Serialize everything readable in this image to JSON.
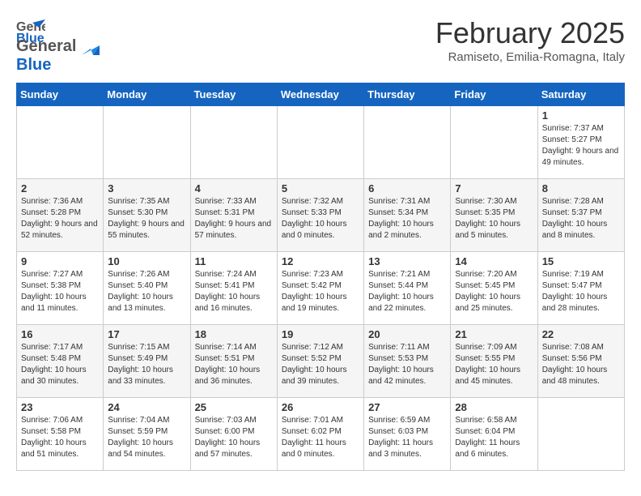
{
  "logo": {
    "general": "General",
    "blue": "Blue"
  },
  "title": "February 2025",
  "location": "Ramiseto, Emilia-Romagna, Italy",
  "weekdays": [
    "Sunday",
    "Monday",
    "Tuesday",
    "Wednesday",
    "Thursday",
    "Friday",
    "Saturday"
  ],
  "rows": [
    {
      "cells": [
        {
          "day": "",
          "info": ""
        },
        {
          "day": "",
          "info": ""
        },
        {
          "day": "",
          "info": ""
        },
        {
          "day": "",
          "info": ""
        },
        {
          "day": "",
          "info": ""
        },
        {
          "day": "",
          "info": ""
        },
        {
          "day": "1",
          "info": "Sunrise: 7:37 AM\nSunset: 5:27 PM\nDaylight: 9 hours and 49 minutes."
        }
      ]
    },
    {
      "cells": [
        {
          "day": "2",
          "info": "Sunrise: 7:36 AM\nSunset: 5:28 PM\nDaylight: 9 hours and 52 minutes."
        },
        {
          "day": "3",
          "info": "Sunrise: 7:35 AM\nSunset: 5:30 PM\nDaylight: 9 hours and 55 minutes."
        },
        {
          "day": "4",
          "info": "Sunrise: 7:33 AM\nSunset: 5:31 PM\nDaylight: 9 hours and 57 minutes."
        },
        {
          "day": "5",
          "info": "Sunrise: 7:32 AM\nSunset: 5:33 PM\nDaylight: 10 hours and 0 minutes."
        },
        {
          "day": "6",
          "info": "Sunrise: 7:31 AM\nSunset: 5:34 PM\nDaylight: 10 hours and 2 minutes."
        },
        {
          "day": "7",
          "info": "Sunrise: 7:30 AM\nSunset: 5:35 PM\nDaylight: 10 hours and 5 minutes."
        },
        {
          "day": "8",
          "info": "Sunrise: 7:28 AM\nSunset: 5:37 PM\nDaylight: 10 hours and 8 minutes."
        }
      ]
    },
    {
      "cells": [
        {
          "day": "9",
          "info": "Sunrise: 7:27 AM\nSunset: 5:38 PM\nDaylight: 10 hours and 11 minutes."
        },
        {
          "day": "10",
          "info": "Sunrise: 7:26 AM\nSunset: 5:40 PM\nDaylight: 10 hours and 13 minutes."
        },
        {
          "day": "11",
          "info": "Sunrise: 7:24 AM\nSunset: 5:41 PM\nDaylight: 10 hours and 16 minutes."
        },
        {
          "day": "12",
          "info": "Sunrise: 7:23 AM\nSunset: 5:42 PM\nDaylight: 10 hours and 19 minutes."
        },
        {
          "day": "13",
          "info": "Sunrise: 7:21 AM\nSunset: 5:44 PM\nDaylight: 10 hours and 22 minutes."
        },
        {
          "day": "14",
          "info": "Sunrise: 7:20 AM\nSunset: 5:45 PM\nDaylight: 10 hours and 25 minutes."
        },
        {
          "day": "15",
          "info": "Sunrise: 7:19 AM\nSunset: 5:47 PM\nDaylight: 10 hours and 28 minutes."
        }
      ]
    },
    {
      "cells": [
        {
          "day": "16",
          "info": "Sunrise: 7:17 AM\nSunset: 5:48 PM\nDaylight: 10 hours and 30 minutes."
        },
        {
          "day": "17",
          "info": "Sunrise: 7:15 AM\nSunset: 5:49 PM\nDaylight: 10 hours and 33 minutes."
        },
        {
          "day": "18",
          "info": "Sunrise: 7:14 AM\nSunset: 5:51 PM\nDaylight: 10 hours and 36 minutes."
        },
        {
          "day": "19",
          "info": "Sunrise: 7:12 AM\nSunset: 5:52 PM\nDaylight: 10 hours and 39 minutes."
        },
        {
          "day": "20",
          "info": "Sunrise: 7:11 AM\nSunset: 5:53 PM\nDaylight: 10 hours and 42 minutes."
        },
        {
          "day": "21",
          "info": "Sunrise: 7:09 AM\nSunset: 5:55 PM\nDaylight: 10 hours and 45 minutes."
        },
        {
          "day": "22",
          "info": "Sunrise: 7:08 AM\nSunset: 5:56 PM\nDaylight: 10 hours and 48 minutes."
        }
      ]
    },
    {
      "cells": [
        {
          "day": "23",
          "info": "Sunrise: 7:06 AM\nSunset: 5:58 PM\nDaylight: 10 hours and 51 minutes."
        },
        {
          "day": "24",
          "info": "Sunrise: 7:04 AM\nSunset: 5:59 PM\nDaylight: 10 hours and 54 minutes."
        },
        {
          "day": "25",
          "info": "Sunrise: 7:03 AM\nSunset: 6:00 PM\nDaylight: 10 hours and 57 minutes."
        },
        {
          "day": "26",
          "info": "Sunrise: 7:01 AM\nSunset: 6:02 PM\nDaylight: 11 hours and 0 minutes."
        },
        {
          "day": "27",
          "info": "Sunrise: 6:59 AM\nSunset: 6:03 PM\nDaylight: 11 hours and 3 minutes."
        },
        {
          "day": "28",
          "info": "Sunrise: 6:58 AM\nSunset: 6:04 PM\nDaylight: 11 hours and 6 minutes."
        },
        {
          "day": "",
          "info": ""
        }
      ]
    }
  ]
}
